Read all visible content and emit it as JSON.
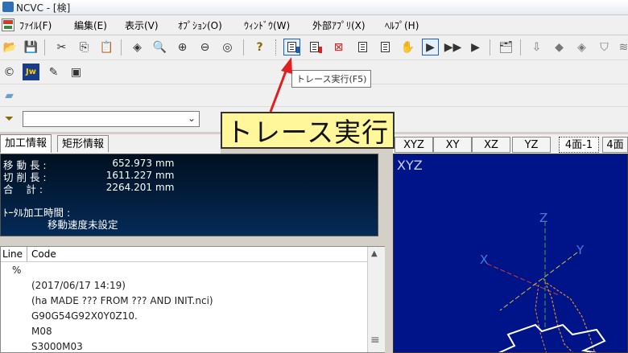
{
  "window": {
    "title": "NCVC - [検]"
  },
  "menu": [
    {
      "label": "ﾌｧｲﾙ(F)"
    },
    {
      "label": "編集(E)"
    },
    {
      "label": "表示(V)"
    },
    {
      "label": "ｵﾌﾟｼｮﾝ(O)"
    },
    {
      "label": "ｳｨﾝﾄﾞｳ(W)"
    },
    {
      "label": "外部ｱﾌﾟﾘ(X)"
    },
    {
      "label": "ﾍﾙﾌﾟ(H)"
    }
  ],
  "toolbar": {
    "help_glyph": "?",
    "row2_labels": {
      "jw": "Jw"
    }
  },
  "tooltip": {
    "text": "トレース実行(F5)"
  },
  "callout": {
    "text": "トレース実行"
  },
  "left_tabs": [
    {
      "label": "加工情報"
    },
    {
      "label": "矩形情報"
    }
  ],
  "info": {
    "rows": [
      {
        "label": "移 動 長 :",
        "value": "652.973",
        "unit": "mm"
      },
      {
        "label": "切 削 長 :",
        "value": "1611.227",
        "unit": "mm"
      },
      {
        "label": "合    計 :",
        "value": "2264.201",
        "unit": "mm"
      }
    ],
    "total_time_label": "ﾄｰﾀﾙ加工時間 :",
    "total_time_value": "移動速度未設定"
  },
  "code": {
    "header_line": "Line",
    "header_code": "Code",
    "lines": [
      {
        "line": "%",
        "code": ""
      },
      {
        "line": "",
        "code": "(2017/06/17 14:19)"
      },
      {
        "line": "",
        "code": "(ha MADE ??? FROM ??? AND INIT.nci)"
      },
      {
        "line": "",
        "code": "G90G54G92X0Y0Z10."
      },
      {
        "line": "",
        "code": "M08"
      },
      {
        "line": "",
        "code": "S3000M03"
      }
    ]
  },
  "view_tabs": [
    {
      "label": "XYZ"
    },
    {
      "label": "XY"
    },
    {
      "label": "XZ"
    },
    {
      "label": "YZ"
    },
    {
      "label": "4面-1"
    },
    {
      "label": "4面"
    }
  ],
  "view": {
    "label": "XYZ",
    "axes": {
      "x": "X",
      "y": "Y",
      "z": "Z"
    },
    "colors": {
      "background": "#00148a",
      "axis_x": "#d23a3a",
      "axis_y": "#d8c23a",
      "axis_z": "#3aa84a",
      "path": "#e88a2a",
      "part": "#ffffff"
    }
  },
  "colors": {
    "callout_bg": "#fff79a",
    "arrow": "#e02020",
    "info_bg": "#052a57"
  }
}
